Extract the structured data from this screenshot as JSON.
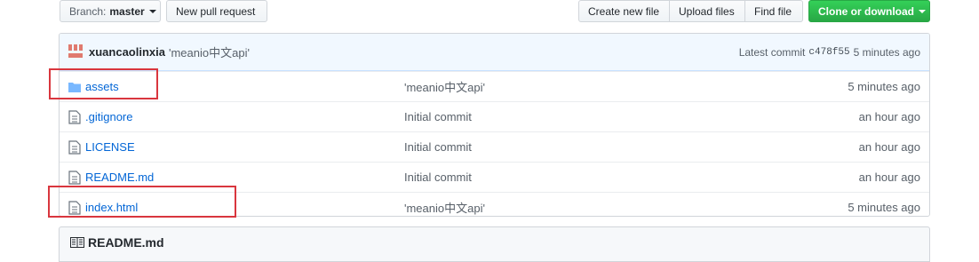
{
  "toolbar": {
    "branch_prefix": "Branch:",
    "branch_name": "master",
    "new_pull_request": "New pull request",
    "create_new_file": "Create new file",
    "upload_files": "Upload files",
    "find_file": "Find file",
    "clone_or_download": "Clone or download"
  },
  "commit": {
    "author": "xuancaolinxia",
    "message": "'meanio中文api'",
    "latest_label": "Latest commit",
    "sha": "c478f55",
    "time": "5 minutes ago"
  },
  "files": [
    {
      "name": "assets",
      "type": "folder",
      "message": "'meanio中文api'",
      "age": "5 minutes ago"
    },
    {
      "name": ".gitignore",
      "type": "file",
      "message": "Initial commit",
      "age": "an hour ago"
    },
    {
      "name": "LICENSE",
      "type": "file",
      "message": "Initial commit",
      "age": "an hour ago"
    },
    {
      "name": "README.md",
      "type": "file",
      "message": "Initial commit",
      "age": "an hour ago"
    },
    {
      "name": "index.html",
      "type": "file",
      "message": "'meanio中文api'",
      "age": "5 minutes ago"
    }
  ],
  "readme": {
    "title": "README.md"
  },
  "colors": {
    "link": "#0366d6",
    "highlight": "#d9363e",
    "green": "#28a745"
  }
}
